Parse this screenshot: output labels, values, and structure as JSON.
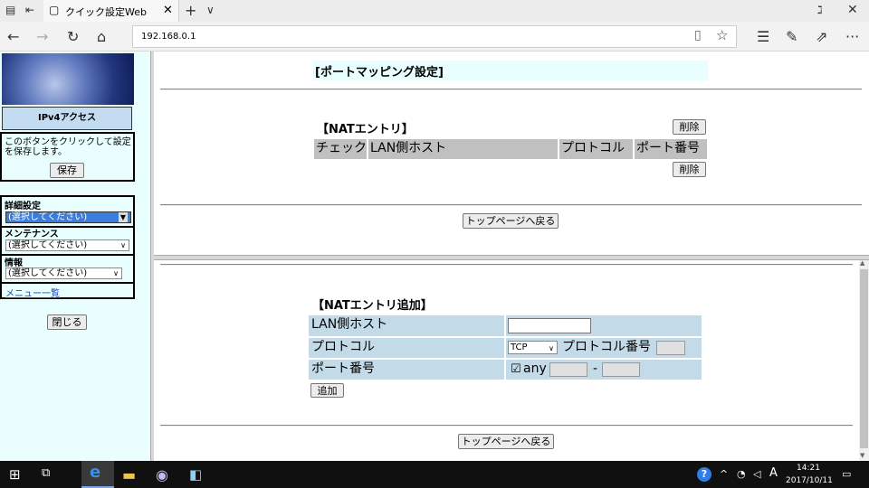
{
  "browser": {
    "tab_title": "クイック設定Web",
    "address": "192.168.0.1",
    "new_tab": "+",
    "tab_menu": "∨",
    "close_tab": "✕",
    "min": "ℷ",
    "close_window": "✕"
  },
  "sidebar": {
    "ipv4_button": "IPv4アクセス",
    "save_hint": "このボタンをクリックして設定を保存します。",
    "save_button": "保存",
    "detail_label": "詳細設定",
    "detail_select": "(選択してください)",
    "maint_label": "メンテナンス",
    "maint_select": "(選択してください)",
    "info_label": "情報",
    "info_select": "(選択してください)",
    "menu_link": "メニュー一覧",
    "close_button": "閉じる"
  },
  "top_frame": {
    "title": "[ポートマッピング設定]",
    "section": "【NATエントリ】",
    "delete_top": "削除",
    "delete_bottom": "削除",
    "columns": [
      "チェック",
      "LAN側ホスト",
      "プロトコル",
      "ポート番号"
    ],
    "back_button": "トップページへ戻る"
  },
  "bottom_frame": {
    "section": "【NATエントリ追加】",
    "row_host": "LAN側ホスト",
    "row_protocol": "プロトコル",
    "protocol_value": "TCP",
    "protocol_no_label": "プロトコル番号",
    "row_port": "ポート番号",
    "any_label": "any",
    "dash": "-",
    "add_button": "追加",
    "back_button": "トップページへ戻る"
  },
  "taskbar": {
    "time": "14:21",
    "date": "2017/10/11",
    "ime": "A"
  }
}
